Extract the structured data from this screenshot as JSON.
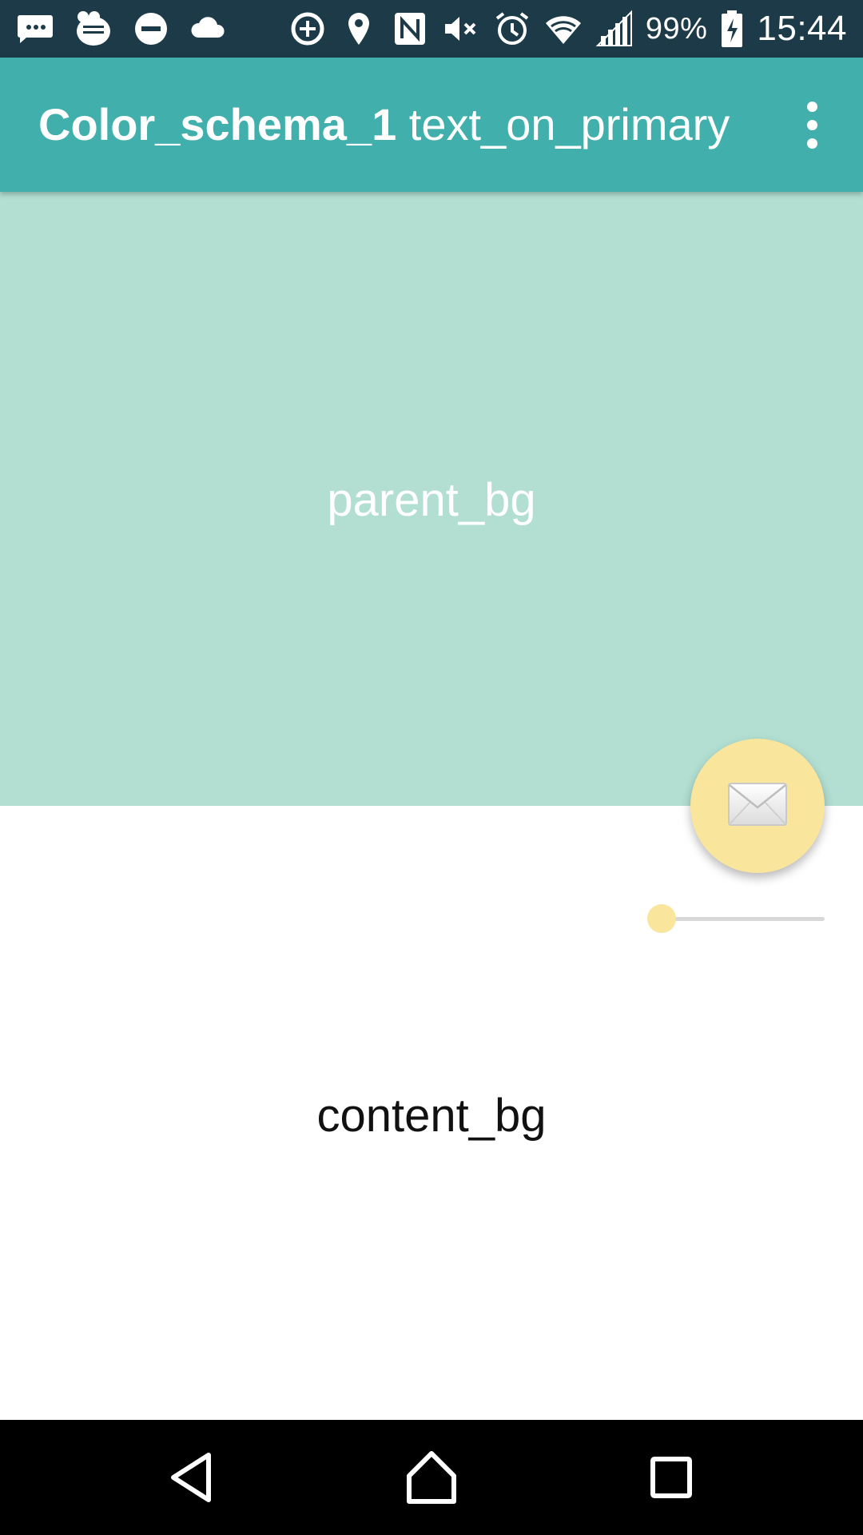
{
  "status_bar": {
    "left_icons": [
      "messaging-icon",
      "osaifu-keitai-icon",
      "do-not-disturb-icon",
      "cloud-icon"
    ],
    "right_icons": [
      "data-saver-icon",
      "location-icon",
      "nfc-icon",
      "mute-icon",
      "alarm-icon",
      "wifi-icon",
      "signal-icon",
      "battery-charging-icon"
    ],
    "battery": "99%",
    "time": "15:44",
    "color": "#1d3a48"
  },
  "app_bar": {
    "title_bold": "Color_schema_1",
    "title_rest": "text_on_primary",
    "overflow_icon": "more-vert-icon",
    "color": "#41b0ac"
  },
  "parent": {
    "label": "parent_bg",
    "color": "#b3dfd3"
  },
  "content": {
    "label": "content_bg",
    "color": "#ffffff"
  },
  "fab": {
    "icon": "envelope-icon",
    "color": "#fae59c"
  },
  "slider": {
    "value": 0
  },
  "nav_bar": {
    "icons": [
      "back-icon",
      "home-icon",
      "recents-icon"
    ],
    "color": "#000000"
  }
}
